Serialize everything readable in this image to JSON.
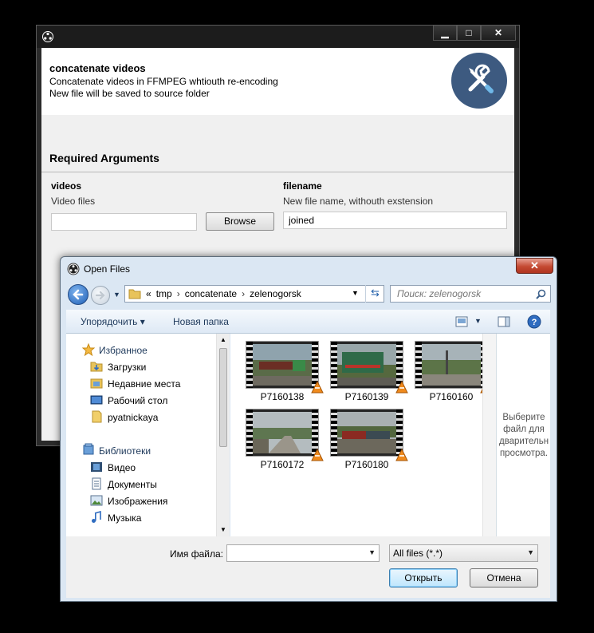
{
  "app": {
    "header_title": "concatenate videos",
    "header_line1": "Concatenate videos in FFMPEG whtiouth re-encoding",
    "header_line2": "New file will be saved to source folder",
    "section_title": "Required Arguments",
    "args": {
      "videos": {
        "name": "videos",
        "help": "Video files",
        "value": "",
        "browse_label": "Browse"
      },
      "filename": {
        "name": "filename",
        "help": "New file name, withouth exstension",
        "value": "joined"
      }
    },
    "caption_buttons": {
      "minimize": "▁",
      "maximize": "□",
      "close": "✕"
    }
  },
  "dialog": {
    "title": "Open Files",
    "close_label": "✕",
    "breadcrumb": [
      "tmp",
      "concatenate",
      "zelenogorsk"
    ],
    "breadcrumb_prefix": "«",
    "search_placeholder": "Поиск: zelenogorsk",
    "toolbar": {
      "organize": "Упорядочить ▾",
      "new_folder": "Новая папка"
    },
    "nav": {
      "favorites_label": "Избранное",
      "favorites": [
        "Загрузки",
        "Недавние места",
        "Рабочий стол",
        "pyatnickaya"
      ],
      "libraries_label": "Библиотеки",
      "libraries": [
        "Видео",
        "Документы",
        "Изображения",
        "Музыка"
      ]
    },
    "files": [
      "P7160138",
      "P7160139",
      "P7160160",
      "P7160172",
      "P7160180"
    ],
    "preview_text": "Выберите файл для дварительн просмотра.",
    "filename_label": "Имя файла:",
    "filename_value": "",
    "filter_value": "All files (*.*)",
    "open_label": "Открыть",
    "cancel_label": "Отмена"
  }
}
